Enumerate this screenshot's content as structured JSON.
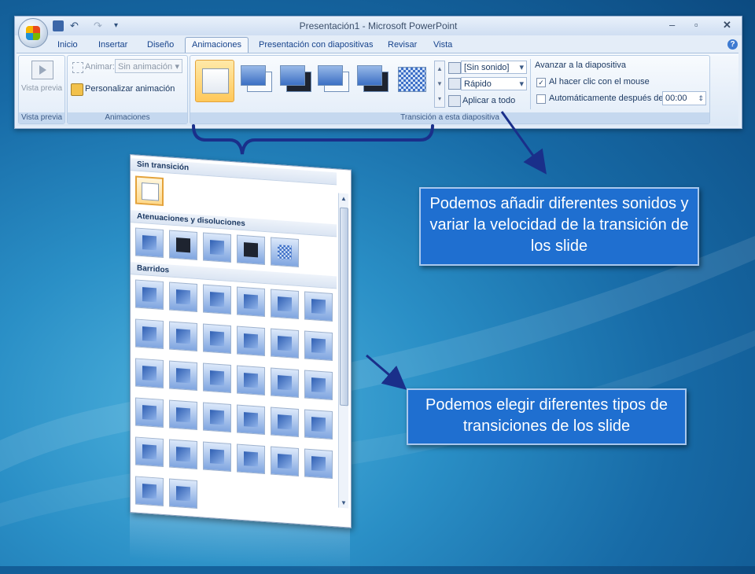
{
  "window": {
    "title": "Presentación1 - Microsoft PowerPoint",
    "qat": {
      "undo": "↶",
      "redo": "↷",
      "customize": "▾"
    },
    "controls": {
      "minimize": "–",
      "maximize": "▫",
      "close": "✕"
    }
  },
  "tabs": [
    {
      "label": "Inicio"
    },
    {
      "label": "Insertar"
    },
    {
      "label": "Diseño"
    },
    {
      "label": "Animaciones",
      "active": true
    },
    {
      "label": "Presentación con diapositivas"
    },
    {
      "label": "Revisar"
    },
    {
      "label": "Vista"
    }
  ],
  "help": "?",
  "ribbon": {
    "preview": {
      "label": "Vista previa",
      "group": "Vista previa"
    },
    "animations": {
      "animar_label": "Animar:",
      "animar_value": "Sin animación",
      "custom_label": "Personalizar animación",
      "group": "Animaciones"
    },
    "transition": {
      "group": "Transición a esta diapositiva",
      "sound": "[Sin sonido]",
      "speed": "Rápido",
      "apply_all": "Aplicar a todo",
      "advance_title": "Avanzar a la diapositiva",
      "on_click": "Al hacer clic con el mouse",
      "on_click_checked": "✓",
      "auto_after": "Automáticamente después de:",
      "time": "00:00"
    },
    "gallery_scroll": {
      "up": "▲",
      "down": "▼",
      "more": "▾"
    }
  },
  "gallery_panel": {
    "sections": [
      "Sin transición",
      "Atenuaciones y disoluciones",
      "Barridos"
    ],
    "scroll": {
      "up": "▲",
      "down": "▼"
    }
  },
  "callouts": {
    "sound_speed": "Podemos añadir diferentes sonidos y variar la velocidad de la transición de los slide",
    "types": "Podemos elegir diferentes tipos de transiciones de los slide"
  },
  "colors": {
    "callout_bg": "#1f6fd0",
    "arrow": "#1a2f8a",
    "accent": "#e4a33b"
  },
  "icons": [
    "office-logo-icon",
    "save-icon",
    "undo-icon",
    "redo-icon",
    "preview-icon",
    "animate-icon",
    "custom-animation-icon",
    "sound-icon",
    "speed-icon",
    "apply-all-icon",
    "help-icon"
  ]
}
